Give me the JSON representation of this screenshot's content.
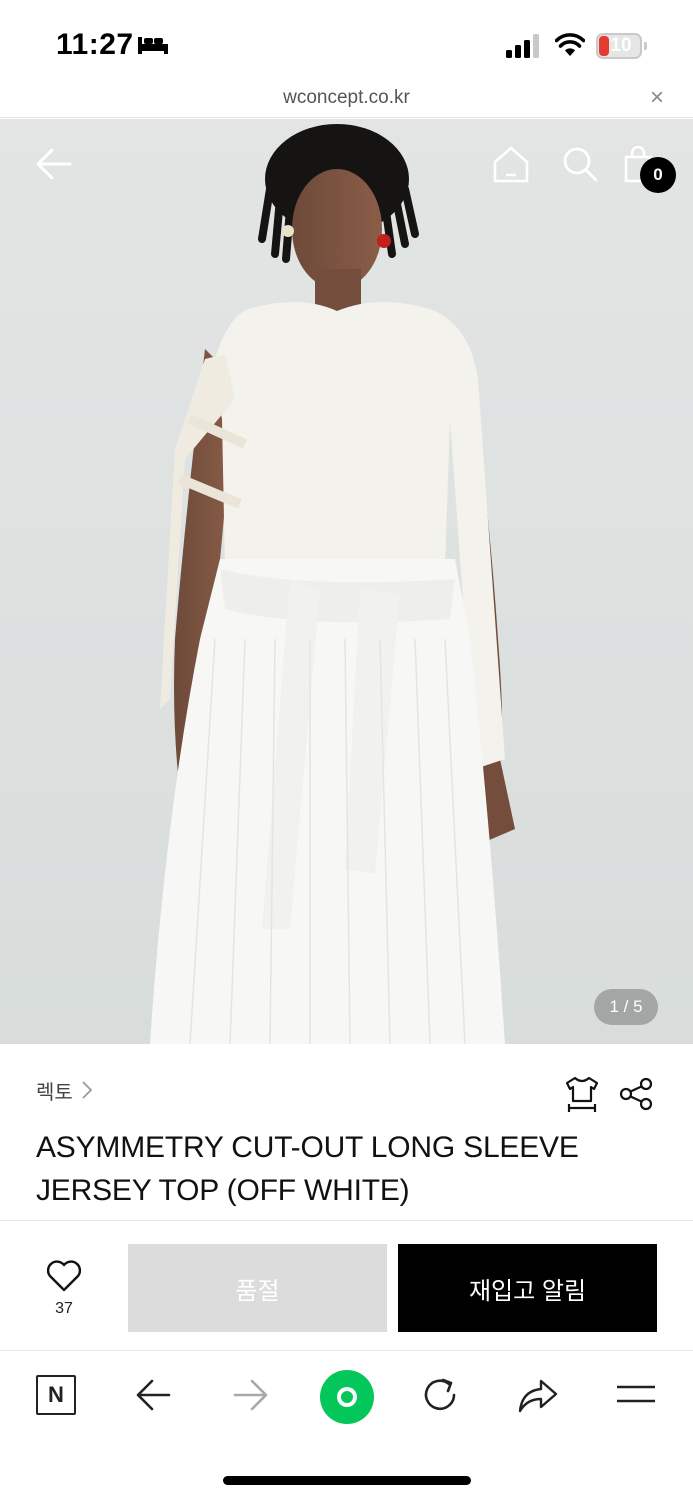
{
  "status_bar": {
    "time": "11:27",
    "battery_level": "10",
    "battery_color": "#e23b32",
    "icons": [
      "bed-icon",
      "signal-icon",
      "wifi-icon",
      "battery-icon"
    ]
  },
  "browser": {
    "url": "wconcept.co.kr",
    "close_icon": "×"
  },
  "hero": {
    "cart_count": "0",
    "page_indicator": "1 / 5",
    "icons": [
      "back-arrow-icon",
      "home-icon",
      "search-icon",
      "shopping-bag-icon"
    ]
  },
  "product": {
    "brand": "렉토",
    "title_line1": "ASYMMETRY CUT-OUT LONG SLEEVE",
    "title_line2": "JERSEY TOP (OFF WHITE)",
    "icons": [
      "size-guide-icon",
      "share-icon"
    ]
  },
  "actions": {
    "like_count": "37",
    "soldout_label": "품절",
    "restock_label": "재입고 알림",
    "soldout_bg": "#dcdcdc",
    "restock_bg": "#000000"
  },
  "toolbar": {
    "n_label": "N",
    "accent": "#03c75a",
    "icons": [
      "naver-n-icon",
      "back-icon",
      "forward-icon",
      "green-dot-icon",
      "reload-icon",
      "share-arrow-icon",
      "menu-icon"
    ]
  }
}
